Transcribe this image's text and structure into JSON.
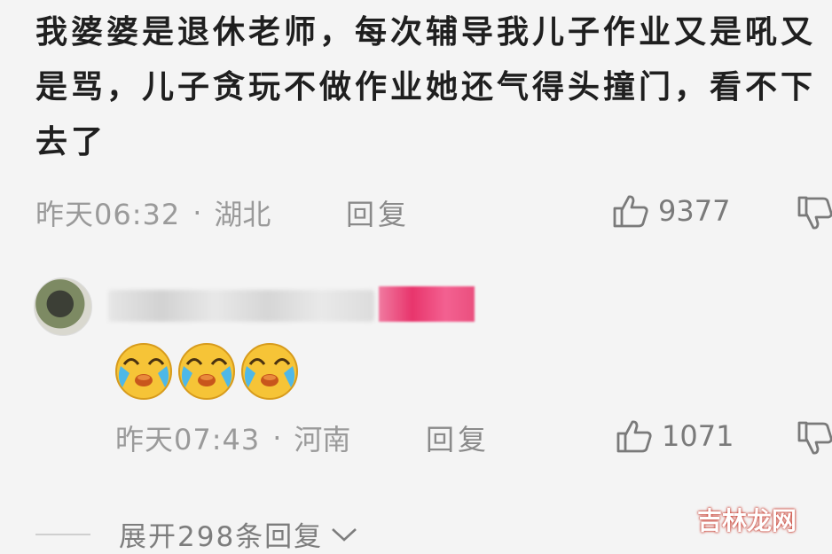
{
  "comment1": {
    "text": "我婆婆是退休老师，每次辅导我儿子作业又是吼又是骂，儿子贪玩不做作业她还气得头撞门，看不下去了",
    "time": "昨天06:32",
    "location": "湖北",
    "reply_label": "回复",
    "likes": "9377"
  },
  "comment2": {
    "emojis": [
      "crying-laughing-emoji",
      "crying-laughing-emoji",
      "crying-laughing-emoji"
    ],
    "time": "昨天07:43",
    "location": "河南",
    "reply_label": "回复",
    "likes": "1071"
  },
  "separator": "·",
  "expand": {
    "label": "展开298条回复"
  },
  "watermark": {
    "text": "吉林龙网"
  },
  "colors": {
    "background": "#f4f4f4",
    "meta_text": "#9a9a9a",
    "badge": "#e8356c",
    "emoji_face": "#f6c437"
  },
  "icons": [
    "thumbs-up-icon",
    "thumbs-down-icon",
    "chevron-down-icon"
  ]
}
